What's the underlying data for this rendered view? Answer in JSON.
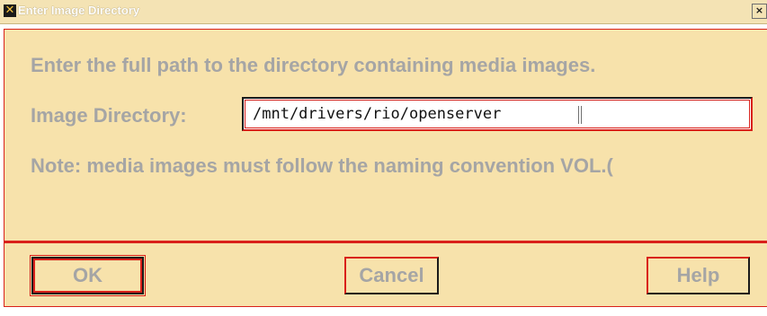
{
  "window": {
    "title": "Enter Image Directory",
    "app_icon": "x-window-icon",
    "close_label": "×"
  },
  "prompt": {
    "intro": "Enter the full path to the directory containing media images.",
    "directory_label": "Image Directory:",
    "directory_value": "/mnt/drivers/rio/openserver",
    "note": "Note: media images must follow the naming convention VOL.("
  },
  "buttons": {
    "ok": "OK",
    "cancel": "Cancel",
    "help": "Help"
  },
  "colors": {
    "title_bar": "#f4e3b4",
    "panel": "#f7e2ab",
    "focus_border": "#d9201a",
    "disabled_text": "#a5a5a5"
  }
}
